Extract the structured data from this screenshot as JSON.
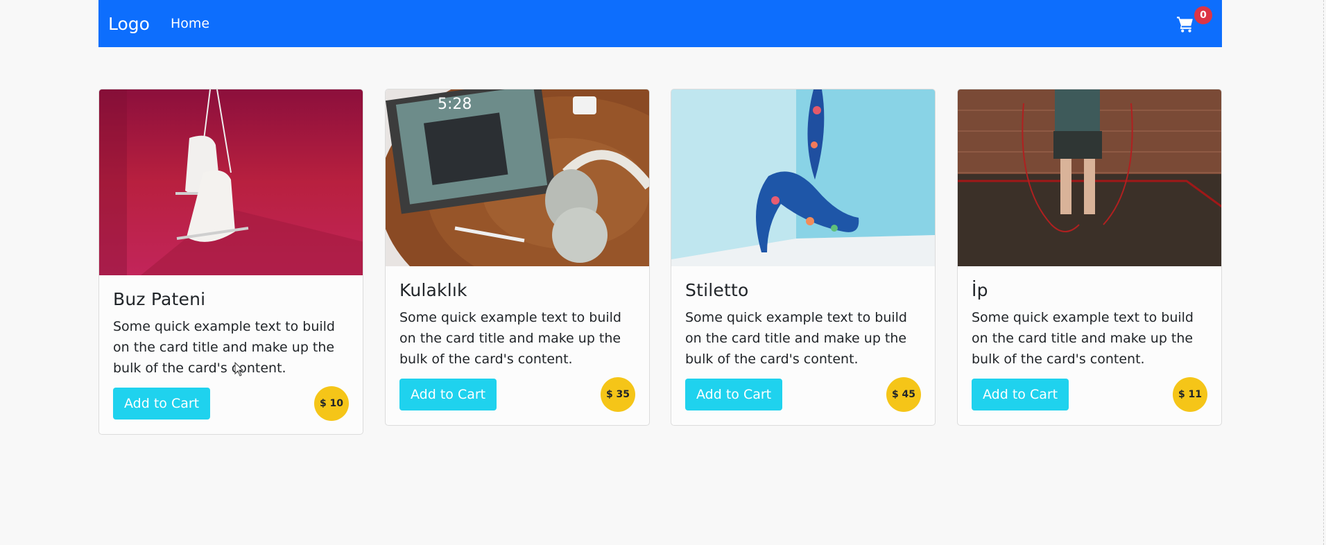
{
  "navbar": {
    "brand": "Logo",
    "links": [
      "Home"
    ],
    "cart_count": "0",
    "cart_icon": "shopping-cart-icon"
  },
  "colors": {
    "navbar": "#0d6efd",
    "button": "#1fd2ee",
    "price_badge": "#f5c518",
    "cart_badge": "#dc3545"
  },
  "products": [
    {
      "title": "Buz Pateni",
      "text": "Some quick example text to build on the card title and make up the bulk of the card's content.",
      "button": "Add to Cart",
      "price": "$ 10",
      "image": "ice-skates-photo"
    },
    {
      "title": "Kulaklık",
      "text": "Some quick example text to build on the card title and make up the bulk of the card's content.",
      "button": "Add to Cart",
      "price": "$ 35",
      "image": "headphones-tablet-photo"
    },
    {
      "title": "Stiletto",
      "text": "Some quick example text to build on the card title and make up the bulk of the card's content.",
      "button": "Add to Cart",
      "price": "$ 45",
      "image": "stiletto-shoe-photo"
    },
    {
      "title": "İp",
      "text": "Some quick example text to build on the card title and make up the bulk of the card's content.",
      "button": "Add to Cart",
      "price": "$ 11",
      "image": "jump-rope-photo"
    }
  ]
}
